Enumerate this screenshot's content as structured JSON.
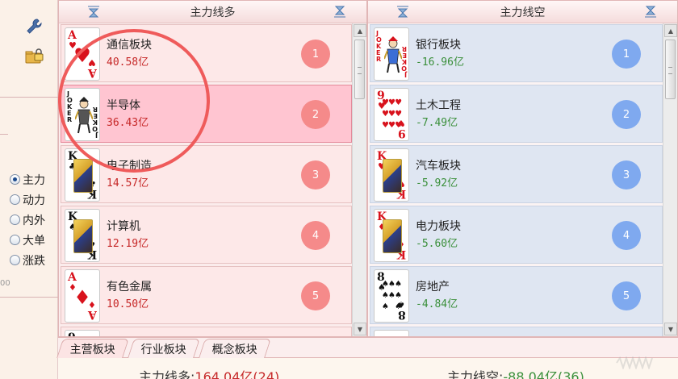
{
  "sidebar": {
    "tools": [
      {
        "icon": "wrench-icon"
      },
      {
        "icon": "lock-folder-icon"
      }
    ],
    "radios": [
      {
        "label": "主力",
        "checked": true
      },
      {
        "label": "动力",
        "checked": false
      },
      {
        "label": "内外",
        "checked": false
      },
      {
        "label": "大单",
        "checked": false
      },
      {
        "label": "涨跌",
        "checked": false
      }
    ],
    "edge_text": "00"
  },
  "long_panel": {
    "title": "主力线多",
    "rows": [
      {
        "name": "通信板块",
        "amount": "40.58亿",
        "rank": "1",
        "card": {
          "type": "pip",
          "rank": "A",
          "suit": "♥",
          "color": "red"
        }
      },
      {
        "name": "半导体",
        "amount": "36.43亿",
        "rank": "2",
        "card": {
          "type": "joker",
          "word": "JOKER",
          "color": "black"
        },
        "selected": true
      },
      {
        "name": "电子制造",
        "amount": "14.57亿",
        "rank": "3",
        "card": {
          "type": "face",
          "rank": "K",
          "suit": "♣",
          "color": "black"
        }
      },
      {
        "name": "计算机",
        "amount": "12.19亿",
        "rank": "4",
        "card": {
          "type": "face",
          "rank": "K",
          "suit": "♠",
          "color": "black"
        }
      },
      {
        "name": "有色金属",
        "amount": "10.50亿",
        "rank": "5",
        "card": {
          "type": "pip",
          "rank": "A",
          "suit": "♦",
          "color": "red"
        }
      },
      {
        "name": "",
        "amount": "",
        "rank": "",
        "card": {
          "type": "partial",
          "rank": "9",
          "color": "black"
        }
      }
    ]
  },
  "short_panel": {
    "title": "主力线空",
    "rows": [
      {
        "name": "银行板块",
        "amount": "-16.96亿",
        "rank": "1",
        "card": {
          "type": "joker",
          "word": "JOKER",
          "color": "red"
        }
      },
      {
        "name": "土木工程",
        "amount": "-7.49亿",
        "rank": "2",
        "card": {
          "type": "pips",
          "rank": "9",
          "suit": "♥",
          "count": 9,
          "color": "red"
        }
      },
      {
        "name": "汽车板块",
        "amount": "-5.92亿",
        "rank": "3",
        "card": {
          "type": "face",
          "rank": "K",
          "suit": "♥",
          "color": "red"
        }
      },
      {
        "name": "电力板块",
        "amount": "-5.60亿",
        "rank": "4",
        "card": {
          "type": "face",
          "rank": "K",
          "suit": "♦",
          "color": "red"
        }
      },
      {
        "name": "房地产",
        "amount": "-4.84亿",
        "rank": "5",
        "card": {
          "type": "pips",
          "rank": "8",
          "suit": "♠",
          "count": 8,
          "color": "black"
        }
      },
      {
        "name": "",
        "amount": "",
        "rank": "",
        "card": {
          "type": "partial",
          "rank": "",
          "color": "black"
        }
      }
    ]
  },
  "tabs": [
    {
      "label": "主营板块",
      "active": true
    },
    {
      "label": "行业板块",
      "active": false
    },
    {
      "label": "概念板块",
      "active": false
    }
  ],
  "summary": {
    "long_label": "主力线多:",
    "long_value": "164.04亿(24)",
    "short_label": "主力线空:",
    "short_value": "-88.04亿(36)"
  },
  "colors": {
    "long_badge": "#f58a8a",
    "short_badge": "#7fa9ef",
    "positive": "#c62828",
    "negative": "#3a8f3a",
    "selected_row": "#ffc5d1"
  }
}
